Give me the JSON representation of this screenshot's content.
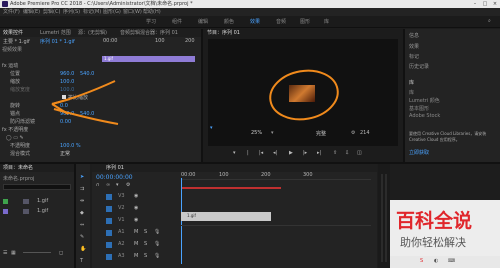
{
  "titlebar": {
    "title": "Adobe Premiere Pro CC 2018 - C:\\Users\\Administrator\\文档\\未命名.prproj *"
  },
  "menubar": {
    "items": [
      "文件(F)",
      "编辑(E)",
      "剪辑(C)",
      "序列(S)",
      "标记(M)",
      "图形(G)",
      "窗口(W)",
      "帮助(H)"
    ]
  },
  "workspaces": {
    "items": [
      "学习",
      "组件",
      "编辑",
      "颜色",
      "效果",
      "音频",
      "图形",
      "库"
    ],
    "active_index": 4
  },
  "effect_controls": {
    "tabs": [
      "效果控件",
      "Lumetri 范围",
      "源：(无剪辑)",
      "音频剪辑混合器：序列 01"
    ],
    "source_label": "主要 * 1.gif",
    "clip_label": "序列 01 * 1.gif",
    "ruler": [
      "00:00",
      "100",
      "200"
    ],
    "section": "视频效果",
    "clip_name": "1.gif",
    "rows": [
      {
        "label": "fx 运动"
      },
      {
        "label": "位置",
        "value": "960.0",
        "value2": "540.0"
      },
      {
        "label": "缩放",
        "value": "100.0"
      },
      {
        "label": "缩放宽度",
        "value": "100.0"
      },
      {
        "label": "等比缩放"
      },
      {
        "label": "旋转",
        "value": "0.0"
      },
      {
        "label": "锚点",
        "value": "960.0",
        "value2": "540.0"
      },
      {
        "label": "防闪烁滤镜",
        "value": "0.00"
      },
      {
        "label": "fx 不透明度"
      },
      {
        "label": "不透明度",
        "value": "100.0 %"
      },
      {
        "label": "混合模式",
        "value": "正常"
      }
    ]
  },
  "program_monitor": {
    "tab": "节目：序列 01",
    "zoom": "25%",
    "quality": "完整",
    "end_time": "214"
  },
  "right_panel": {
    "tabs": [
      "信息",
      "效果",
      "标记",
      "历史记录",
      "库"
    ],
    "items": [
      "库",
      "Lumetri 颜色",
      "基本图形",
      "Adobe Stock"
    ],
    "cc_text": "要使用 Creative Cloud Libraries，请安装 Creative Cloud 应用程序。",
    "link": "立即获取"
  },
  "project_panel": {
    "tab": "项目：未命名",
    "file": "未命名.prproj",
    "items": [
      {
        "name": "1.gif"
      },
      {
        "name": "1.gif"
      }
    ]
  },
  "timeline": {
    "tab": "序列 01",
    "timecode": "00:00:00:00",
    "ruler": [
      "00:00",
      "100",
      "200",
      "300"
    ],
    "tracks": [
      "V3",
      "V2",
      "V1",
      "A1",
      "A2",
      "A3"
    ],
    "clip_label": "1.gif"
  },
  "watermark": {
    "line1": "百科全说",
    "line2": "助你轻松解决"
  },
  "colors": {
    "accent": "#4aa3ff",
    "clip": "#8f7cd6",
    "annotation": "#f08a1c",
    "watermark": "#e0262b"
  }
}
